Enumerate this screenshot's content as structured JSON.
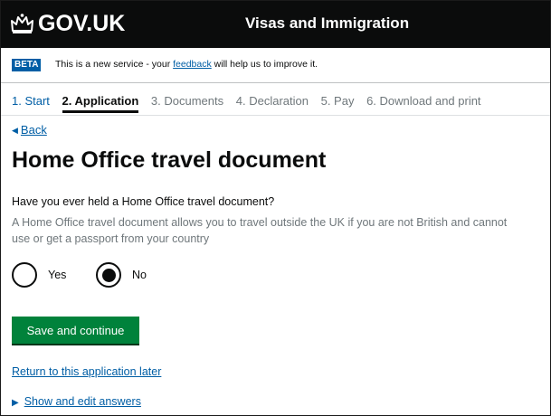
{
  "header": {
    "brand": "GOV.UK",
    "crown_icon": "crown-icon",
    "service_name": "Visas and Immigration"
  },
  "beta": {
    "tag": "BETA",
    "text_before": "This is a new service - your ",
    "link": "feedback",
    "text_after": " will help us to improve it."
  },
  "steps": [
    {
      "label": "1. Start",
      "state": "done"
    },
    {
      "label": "2. Application",
      "state": "current"
    },
    {
      "label": "3. Documents",
      "state": "todo"
    },
    {
      "label": "4. Declaration",
      "state": "todo"
    },
    {
      "label": "5. Pay",
      "state": "todo"
    },
    {
      "label": "6. Download and print",
      "state": "todo"
    }
  ],
  "back_link": "Back",
  "page_title": "Home Office travel document",
  "question": "Have you ever held a Home Office travel document?",
  "hint": "A Home Office travel document allows you to travel outside the UK if you are not British and cannot use or get a passport from your country",
  "radios": {
    "yes": {
      "label": "Yes",
      "selected": false
    },
    "no": {
      "label": "No",
      "selected": true
    }
  },
  "save_button": "Save and continue",
  "return_link": "Return to this application later",
  "show_answers": "Show and edit answers",
  "colors": {
    "header_bg": "#0b0c0c",
    "link": "#005ea5",
    "button": "#00823b",
    "beta_tag": "#005ea5"
  }
}
